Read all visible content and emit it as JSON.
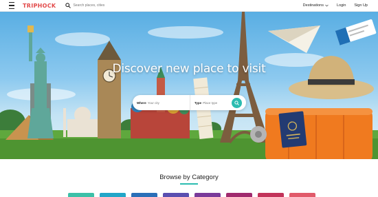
{
  "brand": {
    "name": "TRIPHOCK",
    "color": "#e24a4a"
  },
  "search": {
    "placeholder": "Search places, cities"
  },
  "nav": {
    "destinations": "Destinations",
    "login": "Login",
    "signup": "Sign Up"
  },
  "hero": {
    "title": "Discover new place to visit",
    "where_label": "Where",
    "where_placeholder": "Your city",
    "type_label": "Type",
    "type_placeholder": "Place type"
  },
  "browse": {
    "title": "Browse by Category",
    "accent": "#2bbcb0",
    "tile_colors": [
      "#3cc0a8",
      "#22a6c8",
      "#2a6fb8",
      "#5a4fb0",
      "#7a3a9a",
      "#a02a6e",
      "#c2335a",
      "#e15a6a"
    ]
  },
  "icons": {
    "menu": "hamburger-menu-icon",
    "search": "search-icon",
    "dropdown": "chevron-down-icon",
    "submit": "search-icon"
  }
}
